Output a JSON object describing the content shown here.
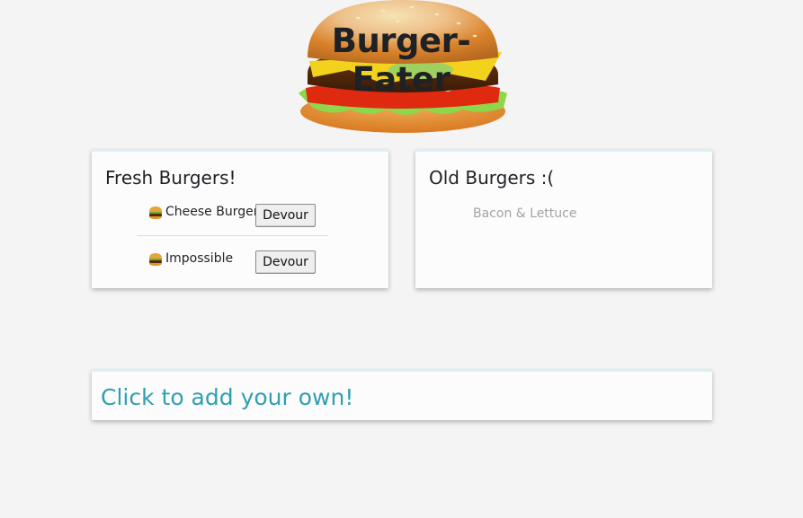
{
  "header": {
    "title": "Burger-Eater"
  },
  "fresh": {
    "title": "Fresh Burgers!",
    "items": [
      {
        "name": "Cheese Burger",
        "button": "Devour"
      },
      {
        "name": "Impossible",
        "button": "Devour"
      }
    ]
  },
  "old": {
    "title": "Old Burgers :(",
    "items": [
      "Bacon & Lettuce"
    ]
  },
  "add": {
    "label": "Click to add your own!"
  },
  "colors": {
    "background": "#f4f4f4",
    "link": "#2f9fb1",
    "devoured_text": "#a3a3a3",
    "title_text": "#1e2125"
  },
  "icons": {
    "item": "hamburger-emoji-icon"
  }
}
